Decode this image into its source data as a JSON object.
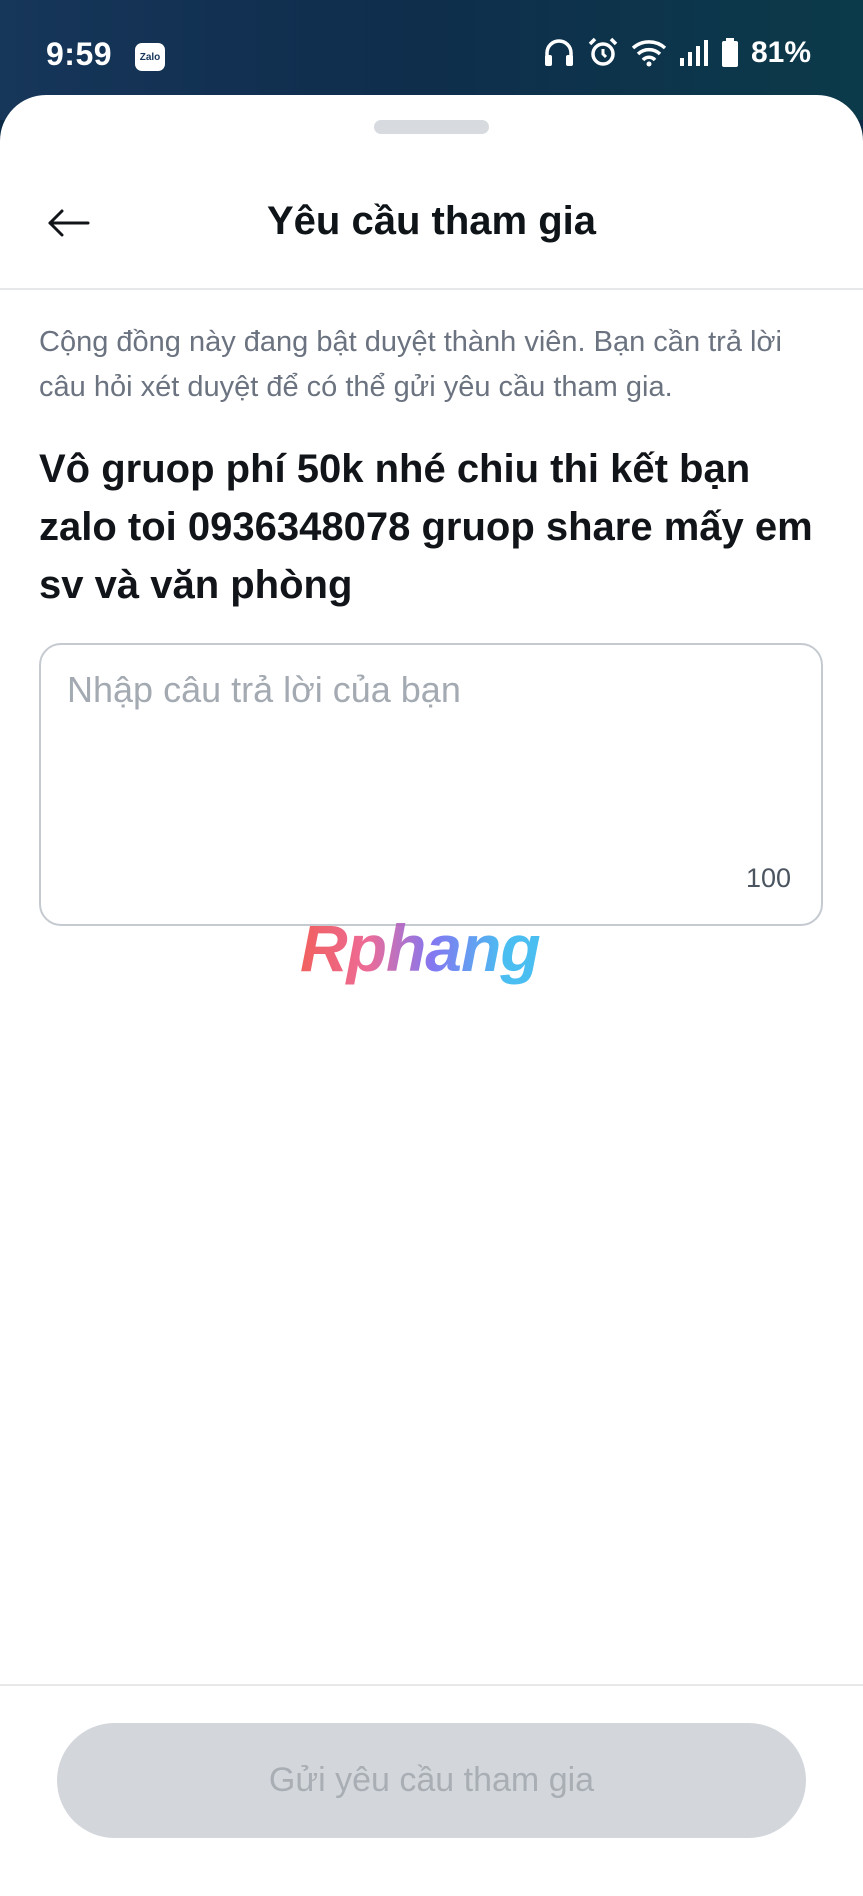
{
  "status_bar": {
    "time": "9:59",
    "app_badge": "Zalo",
    "battery": "81%",
    "icons": [
      "headphones-icon",
      "alarm-icon",
      "wifi-icon",
      "signal-icon",
      "battery-icon"
    ]
  },
  "header": {
    "back_icon": "arrow-left-icon",
    "title": "Yêu cầu tham gia"
  },
  "content": {
    "notice": "Cộng đồng này đang bật duyệt thành viên. Bạn cần trả lời câu hỏi xét duyệt để có thể gửi yêu cầu tham gia.",
    "question": "Vô gruop phí 50k nhé chiu thi kết bạn zalo toi 0936348078 gruop share mấy em sv và văn phòng",
    "answer": {
      "value": "",
      "placeholder": "Nhập câu trả lời của bạn",
      "max_chars": "100"
    },
    "watermark": "Rphang"
  },
  "footer": {
    "submit_label": "Gửi yêu cầu tham gia",
    "submit_enabled": false
  },
  "colors": {
    "status_bar_bg": "#16365a",
    "title_text": "#0f1419",
    "notice_text": "#6b7380",
    "button_disabled_bg": "#d3d7dc",
    "button_disabled_text": "#a9aeb5"
  }
}
